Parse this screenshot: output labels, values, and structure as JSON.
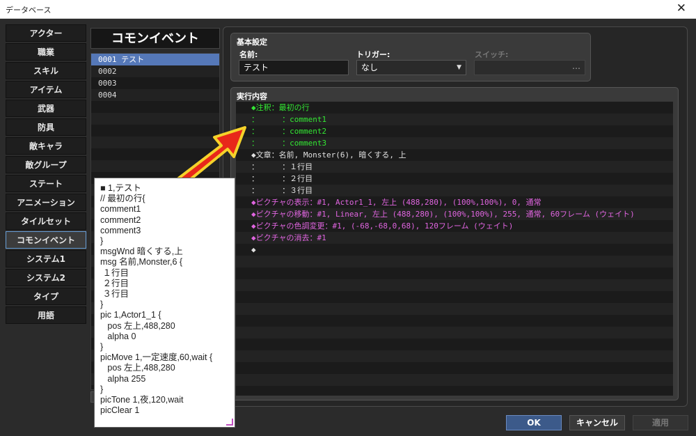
{
  "window": {
    "title": "データベース",
    "close_glyph": "✕"
  },
  "nav": {
    "items": [
      {
        "label": "アクター"
      },
      {
        "label": "職業"
      },
      {
        "label": "スキル"
      },
      {
        "label": "アイテム"
      },
      {
        "label": "武器"
      },
      {
        "label": "防具"
      },
      {
        "label": "敵キャラ"
      },
      {
        "label": "敵グループ"
      },
      {
        "label": "ステート"
      },
      {
        "label": "アニメーション"
      },
      {
        "label": "タイルセット"
      },
      {
        "label": "コモンイベント"
      },
      {
        "label": "システム1"
      },
      {
        "label": "システム2"
      },
      {
        "label": "タイプ"
      },
      {
        "label": "用語"
      }
    ],
    "active_index": 11
  },
  "common_events": {
    "header": "コモンイベント",
    "items": [
      "0001 テスト",
      "0002",
      "0003",
      "0004"
    ],
    "selected_index": 0
  },
  "basic": {
    "title": "基本設定",
    "name_label": "名前:",
    "name_value": "テスト",
    "trigger_label": "トリガー:",
    "trigger_value": "なし",
    "switch_label": "スイッチ:",
    "switch_value": "…"
  },
  "contents": {
    "title": "実行内容",
    "lines": [
      {
        "text": "◆注釈：最初の行",
        "color": "green"
      },
      {
        "text": "：     ：comment1",
        "color": "green"
      },
      {
        "text": "：     ：comment2",
        "color": "green"
      },
      {
        "text": "：     ：comment3",
        "color": "green"
      },
      {
        "text": "◆文章：名前, Monster(6), 暗くする, 上",
        "color": "white"
      },
      {
        "text": "：     ：１行目",
        "color": "white"
      },
      {
        "text": "：     ：２行目",
        "color": "white"
      },
      {
        "text": "：     ：３行目",
        "color": "white"
      },
      {
        "text": "◆ピクチャの表示：#1, Actor1_1, 左上 (488,280), (100%,100%), 0, 通常",
        "color": "pink"
      },
      {
        "text": "◆ピクチャの移動：#1, Linear, 左上 (488,280), (100%,100%), 255, 通常, 60フレーム (ウェイト)",
        "color": "pink"
      },
      {
        "text": "◆ピクチャの色調変更：#1, (-68,-68,0,68), 120フレーム (ウェイト)",
        "color": "pink"
      },
      {
        "text": "◆ピクチャの消去：#1",
        "color": "pink"
      },
      {
        "text": "◆",
        "color": "white"
      }
    ]
  },
  "overlay": {
    "lines": [
      "■ 1,テスト",
      "// 最初の行{",
      "comment1",
      "comment2",
      "comment3",
      "}",
      "msgWnd 暗くする,上",
      "msg 名前,Monster,6 {",
      " １行目",
      " ２行目",
      " ３行目",
      "}",
      "pic 1,Actor1_1 {",
      "   pos 左上,488,280",
      "   alpha 0",
      "}",
      "picMove 1,一定速度,60,wait {",
      "   pos 左上,488,280",
      "   alpha 255",
      "}",
      "picTone 1,夜,120,wait",
      "picClear 1"
    ]
  },
  "buttons": {
    "ok": "OK",
    "cancel": "キャンセル",
    "apply": "適用"
  },
  "colors": {
    "accent": "#5578b8",
    "comment_green": "#33e833",
    "picture_pink": "#e065e0",
    "arrow_red": "#e8281a",
    "arrow_yellow": "#f5d22a"
  }
}
